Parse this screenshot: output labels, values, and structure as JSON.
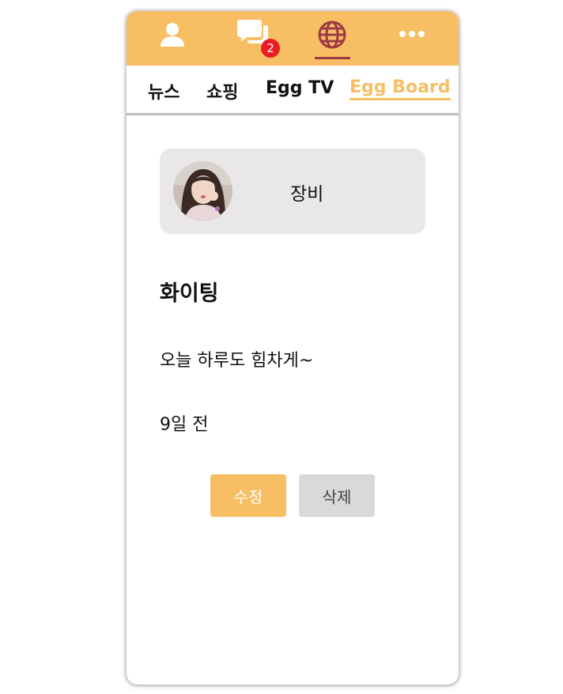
{
  "topbar": {
    "badge_count": "2",
    "icons": [
      "user-icon",
      "chat-icon",
      "globe-icon",
      "more-icon"
    ],
    "active": "globe-icon"
  },
  "tabs": [
    {
      "label": "뉴스",
      "active": false
    },
    {
      "label": "쇼핑",
      "active": false
    },
    {
      "label": "Egg TV",
      "active": false
    },
    {
      "label": "Egg Board",
      "active": true
    }
  ],
  "post": {
    "author": "장비",
    "title": "화이팅",
    "body": "오늘 하루도 힘차게~",
    "time": "9일 전"
  },
  "actions": {
    "edit_label": "수정",
    "delete_label": "삭제"
  },
  "colors": {
    "accent": "#f7be64",
    "active_icon": "#9e3a43",
    "badge": "#ec1c24",
    "card": "#e9e7e8",
    "delete_button": "#d9d9d9"
  }
}
